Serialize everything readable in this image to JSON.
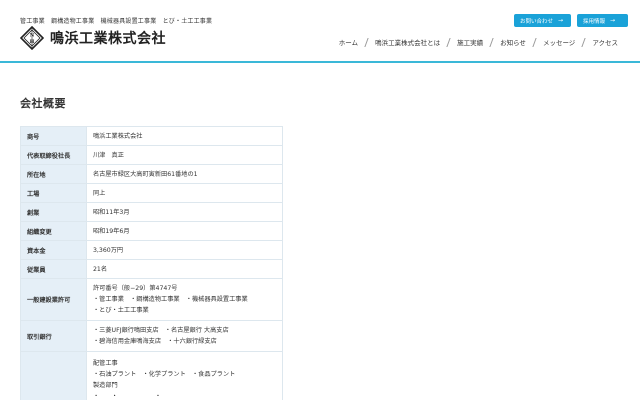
{
  "header": {
    "tagline": "管工事業　鋼構造物工事業　機械器具設置工事業　とび・土工工事業",
    "company_name": "鳴浜工業株式会社",
    "logo_icon": "company-emblem-icon",
    "buttons": [
      {
        "label": "お問い合わせ",
        "icon": "arrow-right-icon"
      },
      {
        "label": "採用情報",
        "icon": "arrow-right-icon"
      }
    ],
    "nav": [
      "ホーム",
      "鳴浜工業株式会社とは",
      "施工実績",
      "お知らせ",
      "メッセージ",
      "アクセス"
    ],
    "accent_color": "#1aa2d8",
    "line_color": "#3ab8d8"
  },
  "main": {
    "title": "会社概要",
    "rows": [
      {
        "label": "商号",
        "value": [
          "鳴浜工業株式会社"
        ]
      },
      {
        "label": "代表取締役社長",
        "value": [
          "川津　真正"
        ]
      },
      {
        "label": "所在地",
        "value": [
          "名古屋市緑区大高町寅新田61番地の1"
        ]
      },
      {
        "label": "工場",
        "value": [
          "同上"
        ]
      },
      {
        "label": "創業",
        "value": [
          "昭和11年3月"
        ]
      },
      {
        "label": "組織変更",
        "value": [
          "昭和19年6月"
        ]
      },
      {
        "label": "資本金",
        "value": [
          "3,360万円"
        ]
      },
      {
        "label": "従業員",
        "value": [
          "21名"
        ]
      },
      {
        "label": "一般建設業許可",
        "value": [
          "許可番号（般−29）第4747号",
          "・管工事業　・鋼構造物工事業　・機械器具設置工事業",
          "・とび・土工工事業"
        ]
      },
      {
        "label": "取引銀行",
        "value": [
          "・三菱UFJ銀行鳴田支店　・名古屋銀行 大高支店",
          "・碧海信用金庫鳴海支店　・十六銀行緑支店"
        ]
      },
      {
        "label": "",
        "value": [
          "配管工事",
          "・石油プラント　・化学プラント　・食品プラント",
          "製造部門",
          "・　　・　　　　　　・　　　　　"
        ]
      }
    ]
  }
}
